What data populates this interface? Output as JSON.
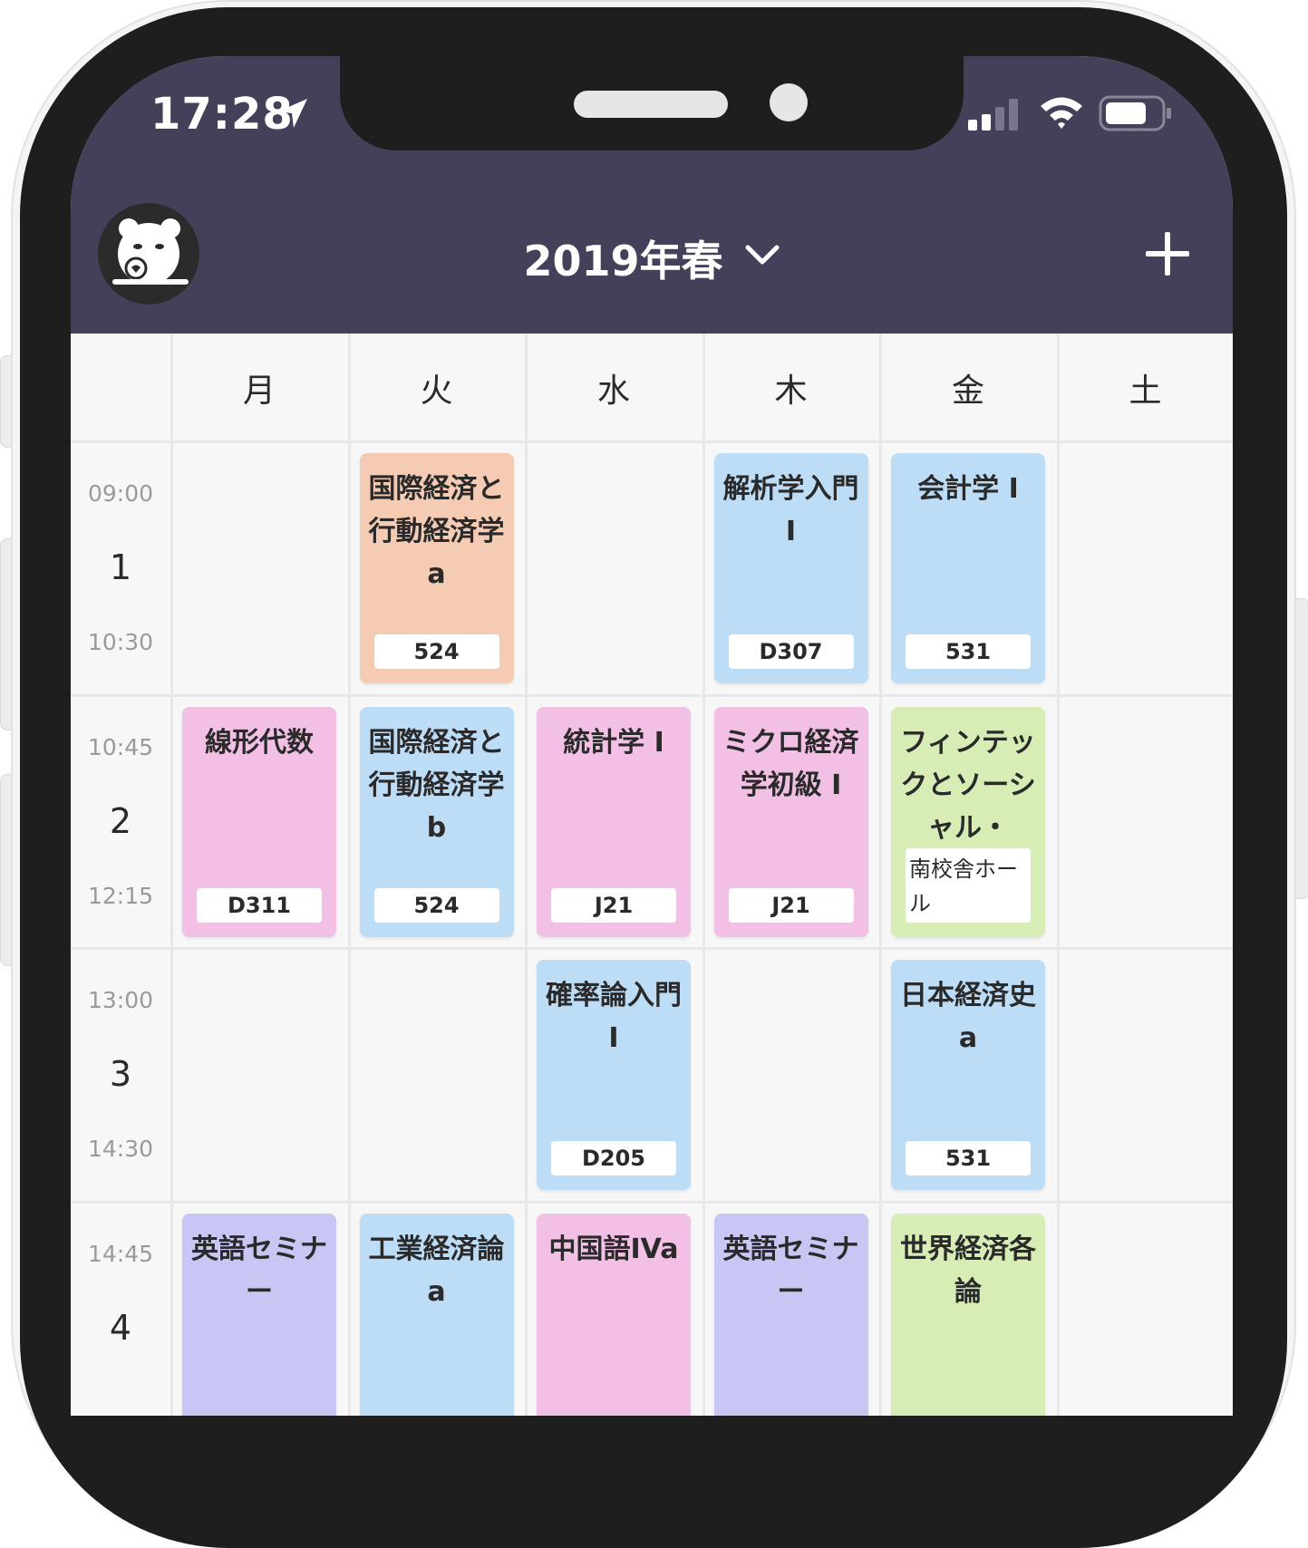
{
  "status_bar": {
    "time": "17:28"
  },
  "header": {
    "term_title": "2019年春",
    "avatar_icon": "panda-avatar-icon",
    "add_icon": "plus-icon"
  },
  "days": [
    "月",
    "火",
    "水",
    "木",
    "金",
    "土"
  ],
  "periods": [
    {
      "num": "1",
      "start": "09:00",
      "end": "10:30"
    },
    {
      "num": "2",
      "start": "10:45",
      "end": "12:15"
    },
    {
      "num": "3",
      "start": "13:00",
      "end": "14:30"
    },
    {
      "num": "4",
      "start": "14:45",
      "end": ""
    }
  ],
  "courses": [
    {
      "name": "国際経済と行動経済学a",
      "room": "524",
      "day_index": 1,
      "period_index": 0,
      "color": "#f6cbb4"
    },
    {
      "name": "解析学入門 I",
      "room": "D307",
      "day_index": 3,
      "period_index": 0,
      "color": "#bddcf6"
    },
    {
      "name": "会計学 I",
      "room": "531",
      "day_index": 4,
      "period_index": 0,
      "color": "#bddcf6"
    },
    {
      "name": "線形代数",
      "room": "D311",
      "day_index": 0,
      "period_index": 1,
      "color": "#f2c0e4"
    },
    {
      "name": "国際経済と行動経済学b",
      "room": "524",
      "day_index": 1,
      "period_index": 1,
      "color": "#bddcf6"
    },
    {
      "name": "統計学 I",
      "room": "J21",
      "day_index": 2,
      "period_index": 1,
      "color": "#f2c0e4"
    },
    {
      "name": "ミクロ経済学初級 I",
      "room": "J21",
      "day_index": 3,
      "period_index": 1,
      "color": "#f2c0e4"
    },
    {
      "name": "フィンテックとソーシャル・",
      "room": "南校舎ホール",
      "day_index": 4,
      "period_index": 1,
      "color": "#d7edb5"
    },
    {
      "name": "確率論入門 I",
      "room": "D205",
      "day_index": 2,
      "period_index": 2,
      "color": "#bddcf6"
    },
    {
      "name": "日本経済史a",
      "room": "531",
      "day_index": 4,
      "period_index": 2,
      "color": "#bddcf6"
    },
    {
      "name": "英語セミナー",
      "room": "",
      "day_index": 0,
      "period_index": 3,
      "color": "#c8c7f4"
    },
    {
      "name": "工業経済論a",
      "room": "",
      "day_index": 1,
      "period_index": 3,
      "color": "#bddcf6"
    },
    {
      "name": "中国語IVa",
      "room": "",
      "day_index": 2,
      "period_index": 3,
      "color": "#f2c0e4"
    },
    {
      "name": "英語セミナー",
      "room": "",
      "day_index": 3,
      "period_index": 3,
      "color": "#c8c7f4"
    },
    {
      "name": "世界経済各論",
      "room": "",
      "day_index": 4,
      "period_index": 3,
      "color": "#d7edb5"
    }
  ]
}
